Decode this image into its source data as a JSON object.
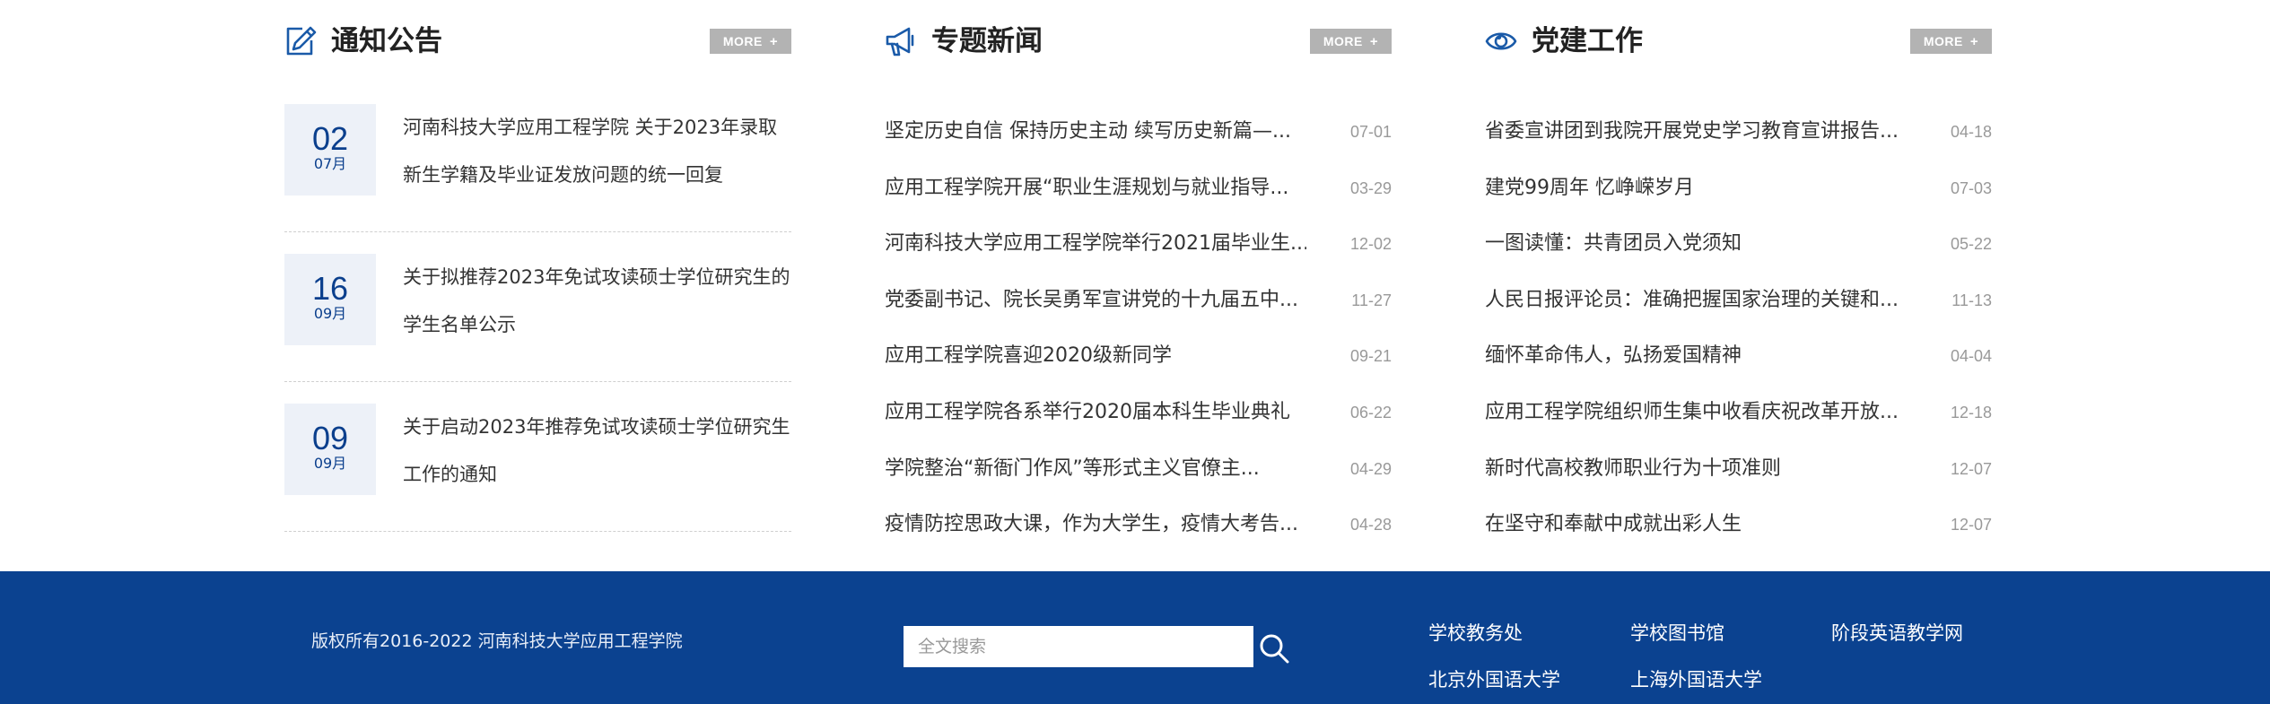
{
  "notice": {
    "title": "通知公告",
    "more": "MORE",
    "items": [
      {
        "day": "02",
        "month": "07月",
        "text": "河南科技大学应用工程学院 关于2023年录取新生学籍及毕业证发放问题的统一回复"
      },
      {
        "day": "16",
        "month": "09月",
        "text": "关于拟推荐2023年免试攻读硕士学位研究生的学生名单公示"
      },
      {
        "day": "09",
        "month": "09月",
        "text": "关于启动2023年推荐免试攻读硕士学位研究生工作的通知"
      }
    ]
  },
  "news": {
    "title": "专题新闻",
    "more": "MORE",
    "items": [
      {
        "title": "坚定历史自信 保持历史主动 续写历史新篇—...",
        "date": "07-01"
      },
      {
        "title": "应用工程学院开展“职业生涯规划与就业指导...",
        "date": "03-29"
      },
      {
        "title": "河南科技大学应用工程学院举行2021届毕业生...",
        "date": "12-02"
      },
      {
        "title": "党委副书记、院长吴勇军宣讲党的十九届五中...",
        "date": "11-27"
      },
      {
        "title": "应用工程学院喜迎2020级新同学",
        "date": "09-21"
      },
      {
        "title": "应用工程学院各系举行2020届本科生毕业典礼",
        "date": "06-22"
      },
      {
        "title": "学院整治“新衙门作风”等形式主义官僚主...",
        "date": "04-29"
      },
      {
        "title": "疫情防控思政大课，作为大学生，疫情大考告...",
        "date": "04-28"
      }
    ]
  },
  "party": {
    "title": "党建工作",
    "more": "MORE",
    "items": [
      {
        "title": "省委宣讲团到我院开展党史学习教育宣讲报告...",
        "date": "04-18"
      },
      {
        "title": "建党99周年 忆峥嵘岁月",
        "date": "07-03"
      },
      {
        "title": "一图读懂：共青团员入党须知",
        "date": "05-22"
      },
      {
        "title": "人民日报评论员：准确把握国家治理的关键和...",
        "date": "11-13"
      },
      {
        "title": "缅怀革命伟人，弘扬爱国精神",
        "date": "04-04"
      },
      {
        "title": "应用工程学院组织师生集中收看庆祝改革开放...",
        "date": "12-18"
      },
      {
        "title": "新时代高校教师职业行为十项准则",
        "date": "12-07"
      },
      {
        "title": "在坚守和奉献中成就出彩人生",
        "date": "12-07"
      }
    ]
  },
  "footer": {
    "copyright": "版权所有2016-2022 河南科技大学应用工程学院",
    "search_placeholder": "全文搜索",
    "links": [
      "学校教务处",
      "学校图书馆",
      "阶段英语教学网",
      "北京外国语大学",
      "上海外国语大学"
    ]
  },
  "icons": {
    "notice": "edit-icon",
    "news": "megaphone-icon",
    "party": "eye-icon",
    "search": "search-icon"
  },
  "colors": {
    "brand": "#0b4290",
    "icon": "#1a5aa8",
    "more_bg": "#b3b3b3",
    "date_bg": "#edf1f8"
  }
}
